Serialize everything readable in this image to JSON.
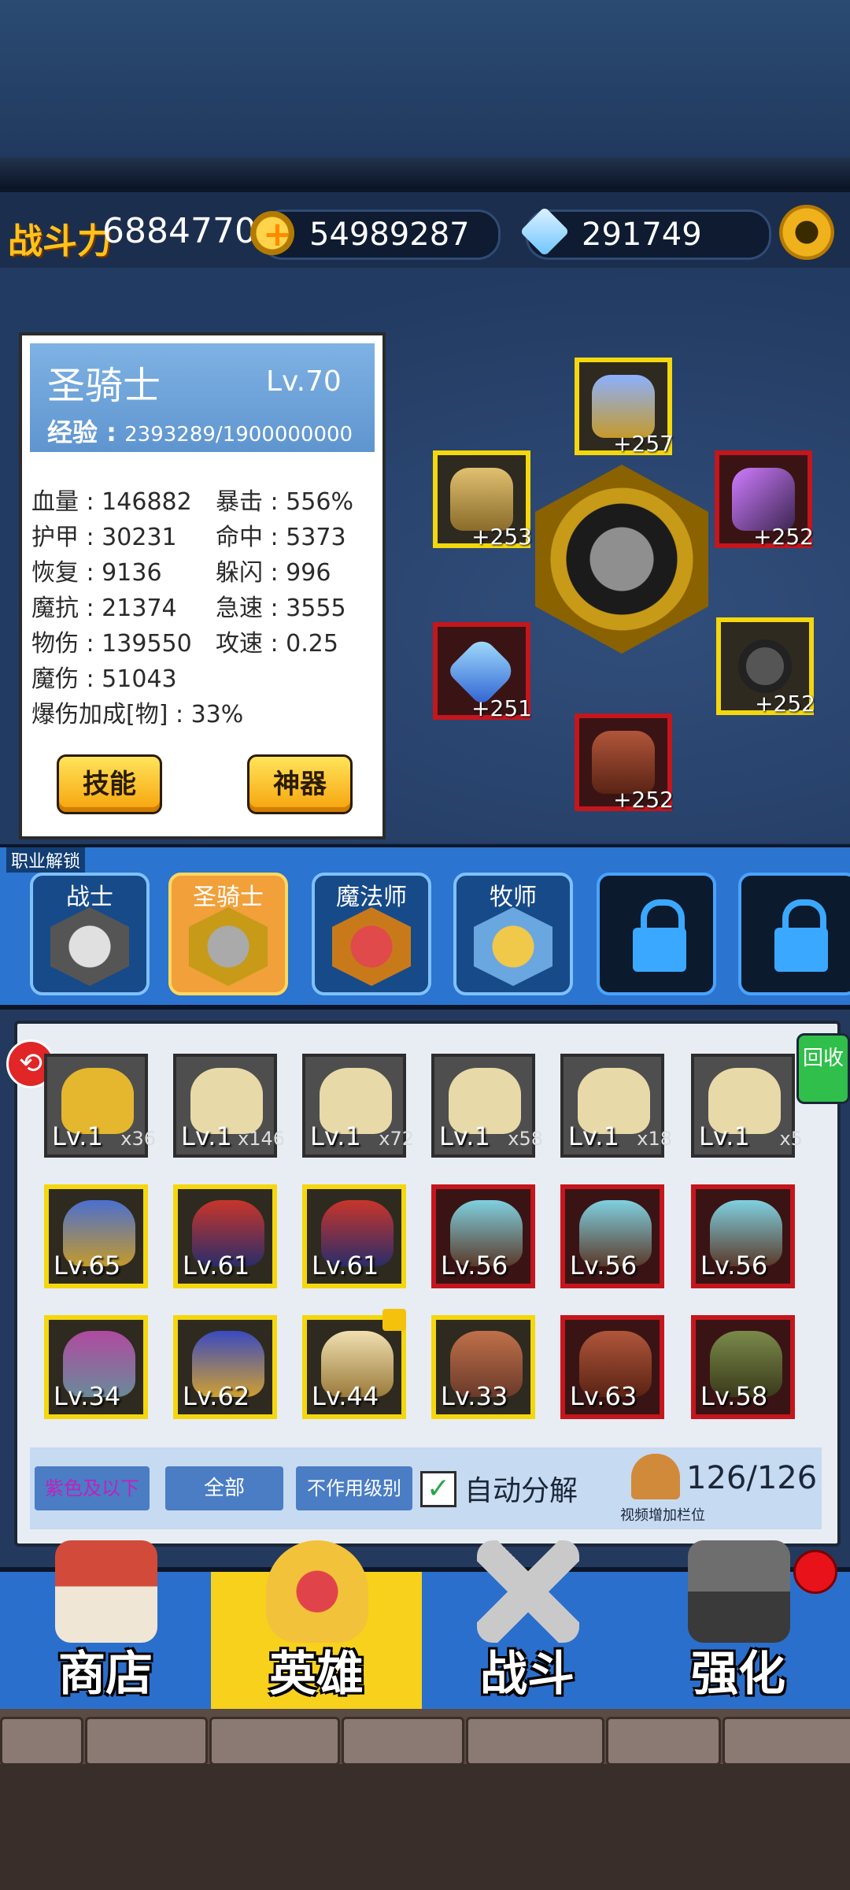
{
  "header": {
    "power_label": "战斗力",
    "power_value": "6884770",
    "gold_value": "54989287",
    "gem_value": "291749"
  },
  "hero": {
    "name": "圣骑士",
    "level": "Lv.70",
    "exp_label": "经验 :",
    "exp_value": "2393289/1900000000",
    "stats": [
      "血量 : 146882",
      "暴击 : 556%",
      "护甲 : 30231",
      "命中 : 5373",
      "恢复 : 9136",
      "躲闪 : 996",
      "魔抗 : 21374",
      "急速 : 3555",
      "物伤 : 139550",
      "攻速 : 0.25",
      "魔伤 : 51043",
      "爆伤加成[物] : 33%"
    ],
    "skill_button": "技能",
    "artifact_button": "神器"
  },
  "equipment": [
    {
      "name": "helmet",
      "bonus": "+257"
    },
    {
      "name": "armor",
      "bonus": "+253"
    },
    {
      "name": "weapon",
      "bonus": "+252"
    },
    {
      "name": "amulet",
      "bonus": "+251"
    },
    {
      "name": "ring",
      "bonus": "+252"
    },
    {
      "name": "boots",
      "bonus": "+252"
    }
  ],
  "classes": {
    "title": "职业解锁",
    "tabs": [
      "战士",
      "圣骑士",
      "魔法师",
      "牧师"
    ]
  },
  "inventory": {
    "row1": [
      {
        "lv": "Lv.1",
        "count": "x36"
      },
      {
        "lv": "Lv.1",
        "count": "x146"
      },
      {
        "lv": "Lv.1",
        "count": "x72"
      },
      {
        "lv": "Lv.1",
        "count": "x58"
      },
      {
        "lv": "Lv.1",
        "count": "x18"
      },
      {
        "lv": "Lv.1",
        "count": "x5"
      }
    ],
    "row2": [
      "Lv.65",
      "Lv.61",
      "Lv.61",
      "Lv.56",
      "Lv.56",
      "Lv.56"
    ],
    "row3": [
      "Lv.34",
      "Lv.62",
      "Lv.44",
      "Lv.33",
      "Lv.63",
      "Lv.58"
    ],
    "recycle_label": "回收"
  },
  "filters": {
    "purple": "紫色及以下",
    "all": "全部",
    "no_level": "不作用级别",
    "auto_decompose": "自动分解",
    "capacity": "126/126",
    "video_slot": "视频增加栏位"
  },
  "nav": [
    "商店",
    "英雄",
    "战斗",
    "强化"
  ]
}
